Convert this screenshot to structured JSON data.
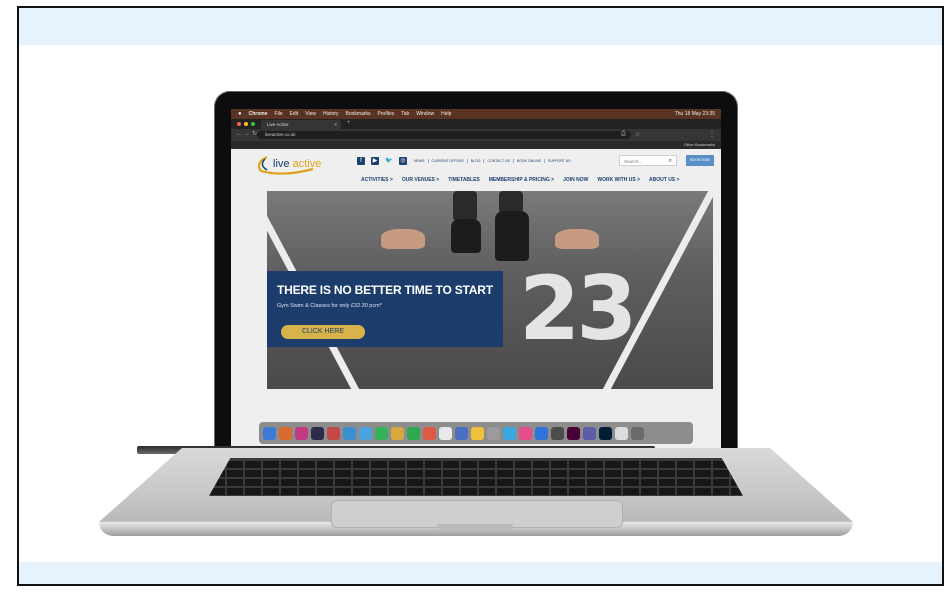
{
  "menubar": {
    "apple": "",
    "items": [
      "Chrome",
      "File",
      "Edit",
      "View",
      "History",
      "Bookmarks",
      "Profiles",
      "Tab",
      "Window",
      "Help"
    ],
    "clock": "Thu 18 May 23:35"
  },
  "browser": {
    "tab_title": "Live Active",
    "url": "liveactive.co.uk",
    "bookmarks_label": "Other Bookmarks"
  },
  "site": {
    "logo_live": "live",
    "logo_active": "active",
    "toplinks": [
      "NEWS",
      "CURRENT OFFERS",
      "BLOG",
      "CONTACT US",
      "BOOK ONLINE",
      "SUPPORT US"
    ],
    "search_placeholder": "Search...",
    "book_now": "BOOK NOW",
    "nav": [
      "ACTIVITIES >",
      "OUR VENUES >",
      "TIMETABLES",
      "MEMBERSHIP & PRICING >",
      "JOIN NOW",
      "WORK WITH US >",
      "ABOUT US >"
    ],
    "hero_number": "23",
    "banner_title": "THERE IS NO BETTER TIME TO START",
    "banner_sub": "Gym Swim & Classes for only £32.30 pcm*",
    "banner_cta": "CLICK HERE"
  },
  "colors": {
    "brand_navy": "#1c3d6c",
    "brand_gold": "#d8b24a",
    "page_band": "#e6f3fc"
  },
  "icons": {
    "social": [
      "facebook-icon",
      "youtube-icon",
      "twitter-icon",
      "instagram-icon"
    ]
  }
}
